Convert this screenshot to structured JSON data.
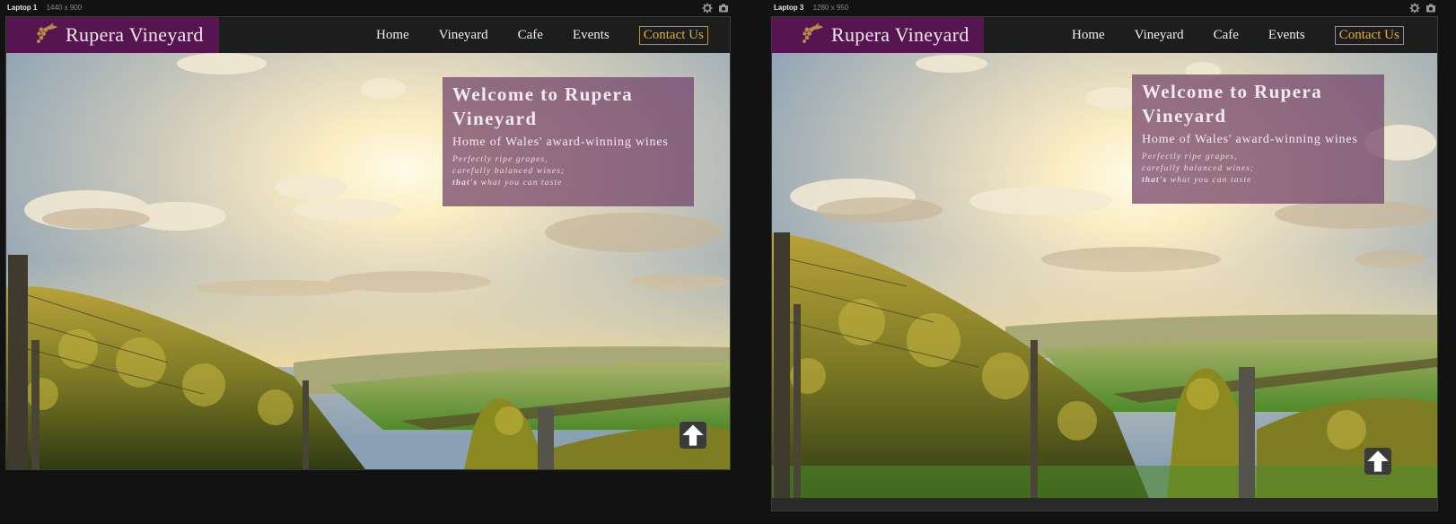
{
  "devices": [
    {
      "name": "Laptop 1",
      "size": "1440 x 900",
      "site": {
        "brand": "Rupera Vineyard",
        "nav": [
          "Home",
          "Vineyard",
          "Cafe",
          "Events"
        ],
        "contact": "Contact Us",
        "hero": {
          "title": "Welcome to Rupera Vineyard",
          "subtitle": "Home of Wales' award-winning wines",
          "tag_line1": "Perfectly ripe grapes,",
          "tag_line2": "carefully balanced wines;",
          "tag_bold": "that's",
          "tag_line3": " what you can taste"
        }
      }
    },
    {
      "name": "Laptop 3",
      "size": "1280 x 950",
      "site": {
        "brand": "Rupera Vineyard",
        "nav": [
          "Home",
          "Vineyard",
          "Cafe",
          "Events"
        ],
        "contact": "Contact Us",
        "hero": {
          "title": "Welcome to Rupera Vineyard",
          "subtitle": "Home of Wales' award-winning wines",
          "tag_line1": "Perfectly ripe grapes,",
          "tag_line2": "carefully balanced wines;",
          "tag_bold": "that's",
          "tag_line3": " what you can taste"
        }
      }
    }
  ],
  "icons": {
    "settings": "gear-icon",
    "screenshot": "camera-icon",
    "logo": "grapes-icon",
    "back_to_top": "arrow-up-icon"
  },
  "colors": {
    "brand_bg": "#561450",
    "header_bg": "#1d1d1d",
    "contact_accent": "#d8b341",
    "overlay": "#704068"
  }
}
